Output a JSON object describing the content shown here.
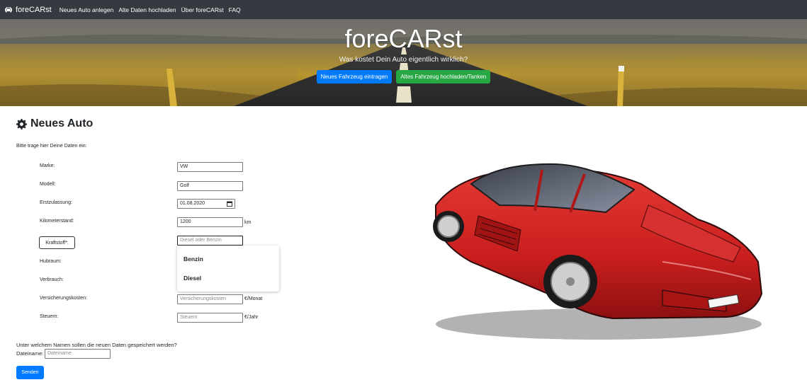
{
  "navbar": {
    "brand": "foreCARst",
    "links": [
      "Neues Auto anlegen",
      "Alte Daten hochladen",
      "Über foreCARst",
      "FAQ"
    ]
  },
  "hero": {
    "title": "foreCARst",
    "subtitle": "Was kostet Dein Auto eigentlich wirklich?",
    "btn_new": "Neues Fahrzeug eintragen",
    "btn_upload": "Altes Fahrzeug hochladen/Tanken"
  },
  "form": {
    "heading": "Neues Auto",
    "intro": "Bitte trage hier Deine Daten ein:",
    "marke": {
      "label": "Marke:",
      "value": "VW"
    },
    "modell": {
      "label": "Modell:",
      "value": "Golf"
    },
    "erstzulassung": {
      "label": "Erstzulassung:",
      "value": "01.08.2020"
    },
    "kilometerstand": {
      "label": "Kilometerstand:",
      "value": "1200",
      "unit": "km"
    },
    "kraftstoff": {
      "button": "Kraftstoff*:",
      "placeholder": "Diesel oder Benzin",
      "options": [
        "Benzin",
        "Diesel"
      ]
    },
    "hubraum": {
      "label": "Hubraum:"
    },
    "verbrauch": {
      "label": "Verbrauch:"
    },
    "versicherung": {
      "label": "Versicherungskosten:",
      "placeholder": "Versicherungskosten",
      "unit": "€/Monat"
    },
    "steuern": {
      "label": "Steuern:",
      "placeholder": "Steuern",
      "unit": "€/Jahr"
    },
    "save_question": "Unter welchem Namen sollen die neuen Daten gespeichert werden?",
    "dateiname": {
      "label": "Dateiname:",
      "placeholder": "Dateiname"
    },
    "send": "Senden"
  },
  "colors": {
    "navbar": "#343a40",
    "primary": "#007bff",
    "success": "#28a745",
    "car_red": "#d42a2a"
  },
  "icons": {
    "brand": "car-icon",
    "heading": "gear-icon",
    "date": "calendar-icon"
  }
}
